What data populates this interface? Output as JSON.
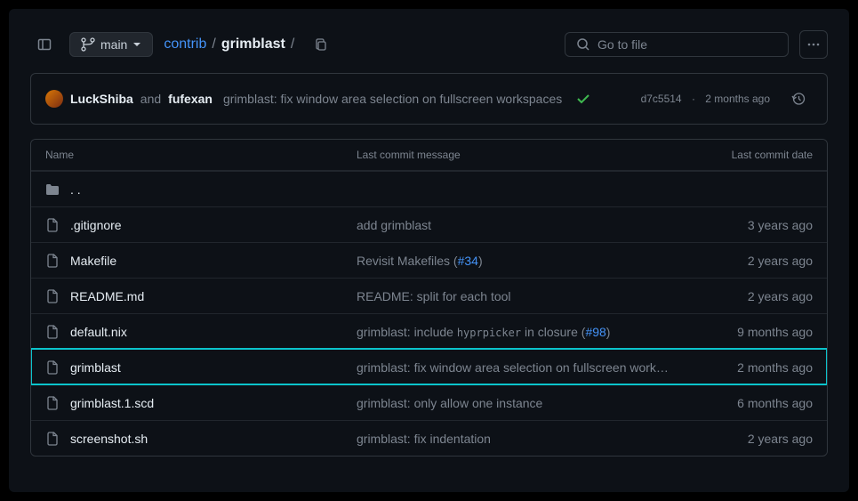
{
  "toolbar": {
    "branch_label": "main",
    "search_placeholder": "Go to file"
  },
  "breadcrumb": {
    "parent": "contrib",
    "current": "grimblast"
  },
  "latest_commit": {
    "author1": "LuckShiba",
    "and": "and",
    "author2": "fufexan",
    "message": "grimblast: fix window area selection on fullscreen workspaces",
    "sha": "d7c5514",
    "date": "2 months ago"
  },
  "headers": {
    "name": "Name",
    "message": "Last commit message",
    "date": "Last commit date"
  },
  "parent_dir": ". .",
  "files": [
    {
      "name": ".gitignore",
      "msg_pre": "add grimblast",
      "issue": "",
      "msg_post": "",
      "date": "3 years ago",
      "hl": false
    },
    {
      "name": "Makefile",
      "msg_pre": "Revisit Makefiles (",
      "issue": "#34",
      "msg_post": ")",
      "date": "2 years ago",
      "hl": false
    },
    {
      "name": "README.md",
      "msg_pre": "README: split for each tool",
      "issue": "",
      "msg_post": "",
      "date": "2 years ago",
      "hl": false
    },
    {
      "name": "default.nix",
      "msg_pre": "grimblast: include ",
      "code": "hyprpicker",
      "msg_mid": " in closure (",
      "issue": "#98",
      "msg_post": ")",
      "date": "9 months ago",
      "hl": false
    },
    {
      "name": "grimblast",
      "msg_pre": "grimblast: fix window area selection on fullscreen work…",
      "issue": "",
      "msg_post": "",
      "date": "2 months ago",
      "hl": true
    },
    {
      "name": "grimblast.1.scd",
      "msg_pre": "grimblast: only allow one instance",
      "issue": "",
      "msg_post": "",
      "date": "6 months ago",
      "hl": false
    },
    {
      "name": "screenshot.sh",
      "msg_pre": "grimblast: fix indentation",
      "issue": "",
      "msg_post": "",
      "date": "2 years ago",
      "hl": false
    }
  ]
}
